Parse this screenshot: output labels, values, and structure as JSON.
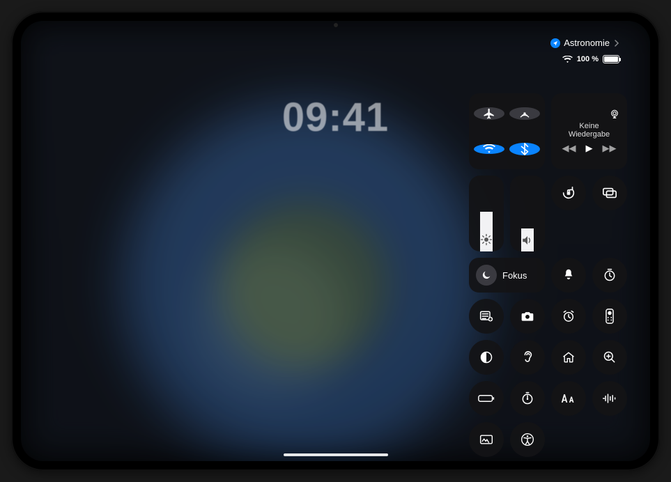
{
  "clock": "09:41",
  "app_return": {
    "label": "Astronomie"
  },
  "status": {
    "battery_text": "100 %"
  },
  "connectivity": {
    "airplane": {
      "on": false
    },
    "airdrop": {
      "on": false
    },
    "wifi": {
      "on": true
    },
    "bluetooth": {
      "on": true
    }
  },
  "media": {
    "now_playing": "Keine Wiedergabe"
  },
  "focus": {
    "label": "Fokus"
  },
  "brightness": {
    "level_pct": 52
  },
  "volume": {
    "level_pct": 30
  },
  "tiles": {
    "orientation_lock": "orientation-lock",
    "screen_mirroring": "screen-mirroring",
    "silent": "silent",
    "timer": "timer",
    "notes": "quick-note",
    "camera": "camera",
    "alarm": "alarm",
    "remote": "apple-tv-remote",
    "dark_mode": "dark-mode",
    "hearing": "hearing",
    "home": "home",
    "magnifier": "magnifier",
    "low_power": "low-power",
    "stopwatch": "stopwatch",
    "text_size": "text-size",
    "voice_memos": "voice-memos",
    "screen_record": "shortcuts",
    "accessibility": "accessibility"
  }
}
